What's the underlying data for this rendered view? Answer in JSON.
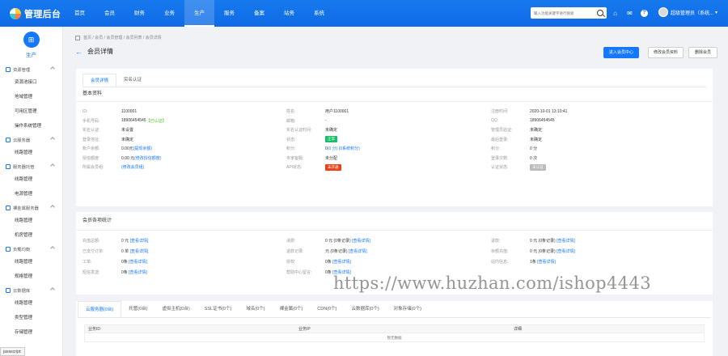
{
  "brand": {
    "title": "管理后台"
  },
  "topnav": [
    "首页",
    "会员",
    "财务",
    "业务",
    "生产",
    "服务",
    "备案",
    "站务",
    "系统"
  ],
  "search": {
    "placeholder": "输入功能关键字进行搜索"
  },
  "user": {
    "name": "超级管理员（系统..."
  },
  "sidebar": {
    "badge_label": "生产",
    "sections": [
      {
        "title": "资源管理",
        "items": [
          "资源池接口",
          "地域管理",
          "可用区管理",
          "操作系统管理"
        ]
      },
      {
        "title": "云服务器",
        "items": [
          "线路管理"
        ]
      },
      {
        "title": "服务器托管",
        "items": [
          "线路管理",
          "电源管理"
        ]
      },
      {
        "title": "裸金属服务器",
        "items": [
          "线路管理",
          "机房管理"
        ]
      },
      {
        "title": "负载均衡",
        "items": [
          "线路管理",
          "规格管理"
        ]
      },
      {
        "title": "云数据库",
        "items": [
          "线路管理",
          "类型管理",
          "存储管理"
        ]
      }
    ]
  },
  "js_tip": "javascript:",
  "breadcrumb": "首页 / 会员 / 会员管理 / 会员列表 / 会员详情",
  "page_title": "会员详情",
  "buttons": {
    "enter_center": "进入会员中心",
    "edit_info": "修改会员资料",
    "delete": "删除会员"
  },
  "tabs": [
    "会员详情",
    "实名认证"
  ],
  "basic": {
    "title": "基本资料",
    "rows": [
      [
        [
          "ID:",
          "1100001"
        ],
        [
          "姓名:",
          "用户1100001"
        ],
        [
          "注册时间:",
          "2020-10-01 13:10:41"
        ]
      ],
      [
        [
          "手机号码:",
          "18906454545"
        ],
        [
          "邮箱:",
          "-"
        ],
        [
          "QQ:",
          "18906454545"
        ]
      ],
      [
        [
          "实名认证:",
          "未设置"
        ],
        [
          "实名认证时间:",
          "未确定"
        ],
        [
          "管理员验证:",
          "未确定"
        ]
      ],
      [
        [
          "登录地址:",
          "未确定"
        ],
        [
          "状态:",
          "正常"
        ],
        [
          "最后登录:",
          "未确定"
        ]
      ],
      [
        [
          "账户余额:",
          "0.00元"
        ],
        [
          "积分:",
          "0"
        ],
        [
          "积分:",
          "0 分"
        ]
      ],
      [
        [
          "授信额度:",
          "0.00 元"
        ],
        [
          "专家客服:",
          "未分配"
        ],
        [
          "登录次数:",
          "0 次"
        ]
      ],
      [
        [
          "所属会员组:",
          "(修改会员组)"
        ],
        [
          "API状态:",
          "未开通"
        ],
        [
          "认证状态:",
          "未认证"
        ]
      ]
    ],
    "phone_verified": "【已认证】",
    "balance_link": "(提现余额)",
    "credit_link": "(修改授信额度)",
    "points_links": "(0 分) (0系统积分)"
  },
  "stats": {
    "title": "会员各项统计",
    "rows": [
      [
        [
          "充值总额:",
          "0 元"
        ],
        [
          "消费:",
          "0 元 (0条记录)"
        ],
        [
          "退款:",
          "0 元 (0条记录)"
        ]
      ],
      [
        [
          "已支付订单:",
          "0 单"
        ],
        [
          "退款记录:",
          "元 (0条记录)"
        ],
        [
          "余额充值:",
          "0 元 (0条记录)"
        ]
      ],
      [
        [
          "工单:",
          "0条"
        ],
        [
          "授权:",
          "0条"
        ],
        [
          "站内信息:",
          "1条"
        ]
      ],
      [
        [
          "短信发送:",
          "0条"
        ],
        [
          "帮助中心留言:",
          "0条"
        ],
        [
          "",
          ""
        ]
      ]
    ],
    "view_link": "[查看详情]"
  },
  "product_tabs": [
    "云服务器(0台)",
    "托管(0台)",
    "虚拟主机(0台)",
    "SSL证书(0个)",
    "域名(0个)",
    "裸金属(0个)",
    "CDN(0个)",
    "云数据库(0个)",
    "对象存储(0个)"
  ],
  "table": {
    "headers": [
      "业务ID",
      "业务IP",
      "详细"
    ],
    "empty": "暂无数据"
  },
  "watermark": "https://www.huzhan.com/ishop4443",
  "colors": {
    "primary": "#1677ff",
    "topbar": "#1679ee"
  }
}
